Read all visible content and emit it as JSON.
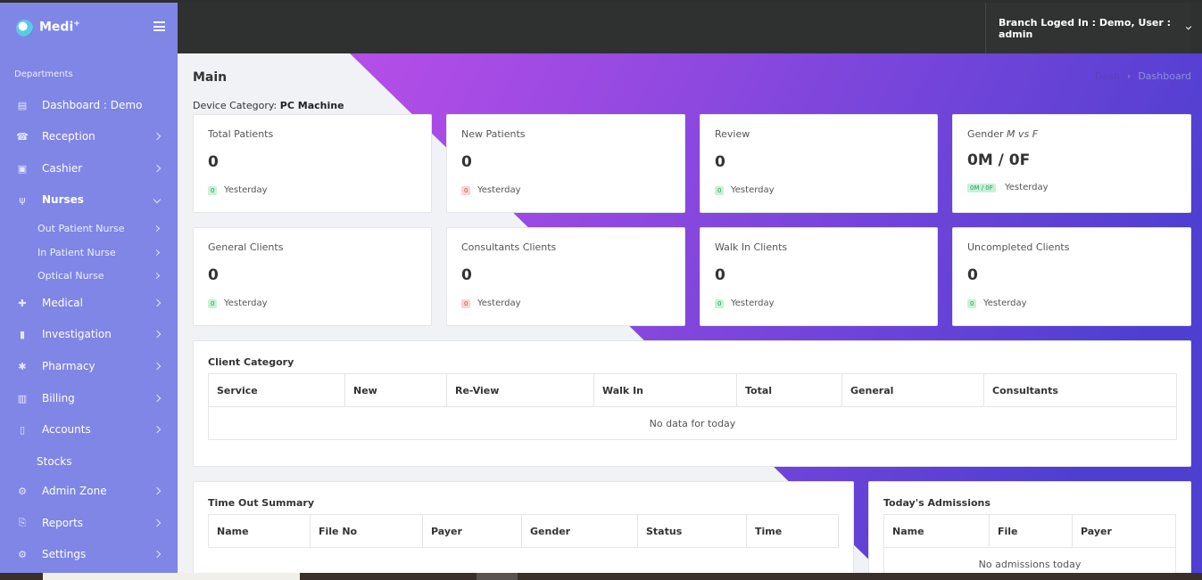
{
  "app": {
    "name": "Medi",
    "name_sup": "+"
  },
  "sidebar": {
    "section_title": "Departments",
    "items": [
      {
        "label": "Dashboard : Demo",
        "icon": "dashboard-icon",
        "has_chevron": false
      },
      {
        "label": "Reception",
        "icon": "reception-icon",
        "has_chevron": true
      },
      {
        "label": "Cashier",
        "icon": "cashier-icon",
        "has_chevron": true
      },
      {
        "label": "Nurses",
        "icon": "stethoscope-icon",
        "has_chevron": true,
        "expanded": true
      },
      {
        "label": "Medical",
        "icon": "medical-kit-icon",
        "has_chevron": true
      },
      {
        "label": "Investigation",
        "icon": "test-tube-icon",
        "has_chevron": true
      },
      {
        "label": "Pharmacy",
        "icon": "pharmacy-icon",
        "has_chevron": true
      },
      {
        "label": "Billing",
        "icon": "billing-icon",
        "has_chevron": true
      },
      {
        "label": "Accounts",
        "icon": "document-icon",
        "has_chevron": true
      },
      {
        "label": "Stocks",
        "icon": "",
        "has_chevron": false
      },
      {
        "label": "Admin Zone",
        "icon": "gear-icon",
        "has_chevron": true
      },
      {
        "label": "Reports",
        "icon": "report-icon",
        "has_chevron": true
      },
      {
        "label": "Settings",
        "icon": "gear-icon",
        "has_chevron": true
      }
    ],
    "sub_items": [
      {
        "label": "Out Patient Nurse"
      },
      {
        "label": "In Patient Nurse"
      },
      {
        "label": "Optical Nurse"
      }
    ]
  },
  "topbar": {
    "user_text": "Branch Loged In : Demo, User : admin"
  },
  "main": {
    "title": "Main",
    "breadcrumb": {
      "home": "Dash",
      "current": "Dashboard"
    },
    "device_label": "Device Category:",
    "device_value": "PC Machine"
  },
  "stats": [
    {
      "title": "Total Patients",
      "value": "0",
      "badge": "0",
      "badge_color": "green",
      "sub": "Yesterday"
    },
    {
      "title": "New Patients",
      "value": "0",
      "badge": "0",
      "badge_color": "red",
      "sub": "Yesterday"
    },
    {
      "title": "Review",
      "value": "0",
      "badge": "0",
      "badge_color": "green",
      "sub": "Yesterday"
    },
    {
      "title": "Gender",
      "title_em": "M vs F",
      "value": "0M / 0F",
      "badge": "0M / 0F",
      "badge_color": "green",
      "sub": "Yesterday"
    },
    {
      "title": "General Clients",
      "value": "0",
      "badge": "0",
      "badge_color": "green",
      "sub": "Yesterday"
    },
    {
      "title": "Consultants Clients",
      "value": "0",
      "badge": "0",
      "badge_color": "red",
      "sub": "Yesterday"
    },
    {
      "title": "Walk In Clients",
      "value": "0",
      "badge": "0",
      "badge_color": "green",
      "sub": "Yesterday"
    },
    {
      "title": "Uncompleted Clients",
      "value": "0",
      "badge": "0",
      "badge_color": "green",
      "sub": "Yesterday"
    }
  ],
  "client_category": {
    "title": "Client Category",
    "columns": [
      "Service",
      "New",
      "Re-View",
      "Walk In",
      "Total",
      "General",
      "Consultants"
    ],
    "empty": "No data for today"
  },
  "time_out": {
    "title": "Time Out Summary",
    "columns": [
      "Name",
      "File No",
      "Payer",
      "Gender",
      "Status",
      "Time"
    ]
  },
  "admissions": {
    "title": "Today's Admissions",
    "columns": [
      "Name",
      "File",
      "Payer"
    ],
    "empty": "No admissions today"
  },
  "colors": {
    "sidebar": "#7f86e5",
    "topbar": "#2f3131",
    "gradient_start": "#b24ee8",
    "gradient_end": "#4f3fd1"
  }
}
